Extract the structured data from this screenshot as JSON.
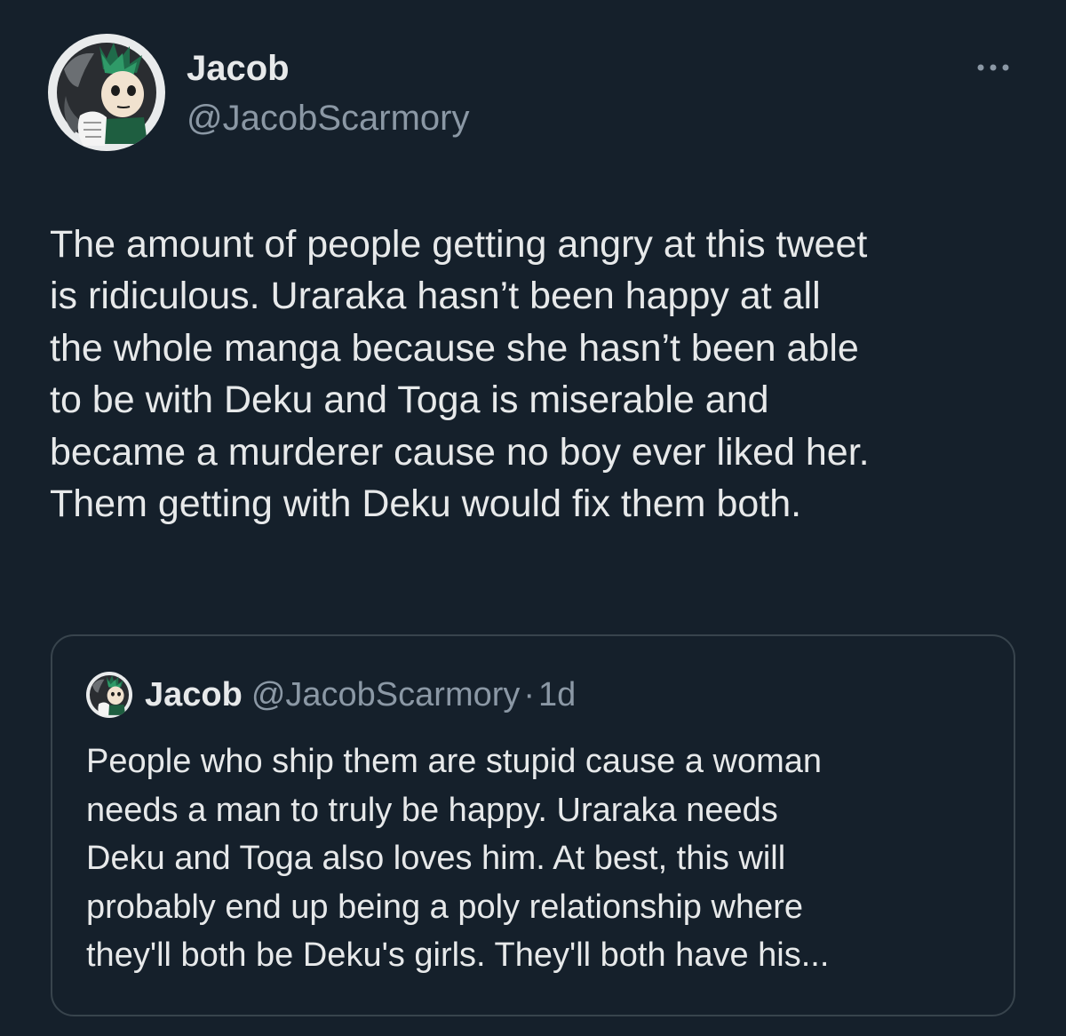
{
  "tweet": {
    "author": {
      "display_name": "Jacob",
      "handle": "@JacobScarmory",
      "avatar": "anime-character-avatar"
    },
    "more_icon": "more-options-icon",
    "text": "The amount of people getting angry at this tweet\nis ridiculous. Uraraka hasn’t been happy at all\nthe whole manga because she hasn’t been able\nto be with Deku and Toga is miserable and\nbecame a murderer cause no boy ever liked her.\nThem getting with Deku would fix them both."
  },
  "quoted_tweet": {
    "author": {
      "display_name": "Jacob",
      "handle": "@JacobScarmory",
      "avatar": "anime-character-avatar"
    },
    "separator": "·",
    "time": "1d",
    "text": "People who ship them are stupid cause a woman\nneeds a man to truly be happy. Uraraka needs\nDeku and Toga also loves him. At best, this will\nprobably end up being a poly relationship where\nthey'll both be Deku's girls. They'll both have his..."
  },
  "colors": {
    "background": "#15202b",
    "primary_text": "#e7e9ea",
    "secondary_text": "#8b98a5",
    "border": "#38444d"
  }
}
